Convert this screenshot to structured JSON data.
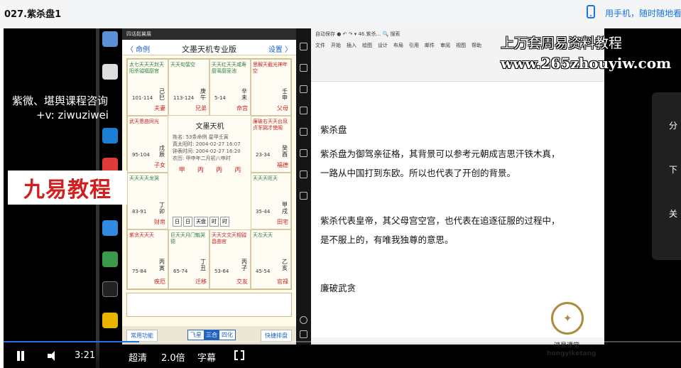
{
  "page": {
    "title": "027.紫杀盘1",
    "phone_text": "用手机，随时随地看"
  },
  "watermarks": {
    "left_line1": "紫微、堪舆课程咨询",
    "left_line2": "+v: ziwuziwei",
    "jiuyi": "九易教程",
    "top": "上万套周易资料教程",
    "url": "www.265zhouyiw.com"
  },
  "app1": {
    "window_title": "四话鬆翼展",
    "back": "〈 命例",
    "title": "文墨天机专业版",
    "settings": "设置 〉",
    "center_title": "文墨天机",
    "center_info": [
      "姓名: 53条命例  星甲壬寅",
      "真太阳时: 2004-02-27 16:07",
      "钟表时间: 2004-02-27 16:20",
      "农历: 甲申年二月初八申时"
    ],
    "bazi": [
      "甲",
      "丙",
      "丙",
      "丙"
    ],
    "center_buttons": [
      "日",
      "日",
      "天盘",
      "时",
      "时"
    ],
    "cells": [
      {
        "stars": "太七天天天封天阳杀钺福厨官",
        "ages": "101-114",
        "gz": "己巳",
        "palace": "夫妻"
      },
      {
        "stars": "天天旬蜚空",
        "ages": "113-124",
        "gz": "庚午",
        "palace": "兄弟"
      },
      {
        "stars": "天天红天天咸寿厨鸾厨巫池",
        "ages": "5-14",
        "gz": "辛未",
        "palace": "命宫"
      },
      {
        "stars": "思解天截光神年空",
        "ages": "",
        "gz": "壬申",
        "palace": "父母"
      },
      {
        "stars": "武天恩曲同光",
        "ages": "95-104",
        "gz": "戊辰",
        "palace": "子女"
      },
      {
        "stars": "廉破右天天台风贞军弼才使阁",
        "ages": "23-34",
        "gz": "癸酉",
        "palace": "福德"
      },
      {
        "stars": "天天天天龙哭",
        "ages": "83-91",
        "gz": "丁卯",
        "palace": "财帛"
      },
      {
        "stars": "天天天旺天",
        "ages": "35-44",
        "gz": "甲戌",
        "palace": "田宅"
      },
      {
        "stars": "紫贪天天天",
        "ages": "75-84",
        "gz": "丙寅",
        "palace": "疾厄"
      },
      {
        "stars": "巨天天月门魁哭德",
        "ages": "65-74",
        "gz": "丁丑",
        "palace": "迁移"
      },
      {
        "stars": "天天文文天相钺昌曲官",
        "ages": "53-64",
        "gz": "丙子",
        "palace": "交友"
      },
      {
        "stars": "天左天天",
        "ages": "45-54",
        "gz": "乙亥",
        "palace": "官禄"
      }
    ],
    "footer_left": "常用功能",
    "footer_seg": [
      "飞星",
      "三合",
      "四化"
    ],
    "footer_right": "快捷排盘"
  },
  "word": {
    "titlebar": "自动保存 ●  ↶ ↷ ▾   46.紫杀...    🔍 搜索",
    "menus": [
      "文件",
      "开始",
      "插入",
      "绘图",
      "设计",
      "布局",
      "引用",
      "邮件",
      "审阅",
      "视图",
      "帮助"
    ],
    "heading": "紫杀盘",
    "p1": "紫杀盘为御驾亲征格，其背景可以参考元朝成吉思汗铁木真，",
    "p2": "一路从中国打到东欧。所以也代表了开创的背景。",
    "p3": "紫杀代表皇帝，其父母宫空宫，也代表在追逐征服的过程中，",
    "p4": "是不服上的，有唯我独尊的意思。",
    "p5": "廉破武贪"
  },
  "logo": {
    "name_cn": "鸿易课堂",
    "name_en": "hongyiketang"
  },
  "right_panel": {
    "items": [
      "分",
      "下",
      "关"
    ]
  },
  "controls": {
    "time": "3:21",
    "quality": "超清",
    "speed": "2.0倍",
    "subtitle": "字幕",
    "progress": 0.2
  },
  "colors": {
    "accent": "#1a73e8",
    "jiuyi": "#d21f1f"
  }
}
